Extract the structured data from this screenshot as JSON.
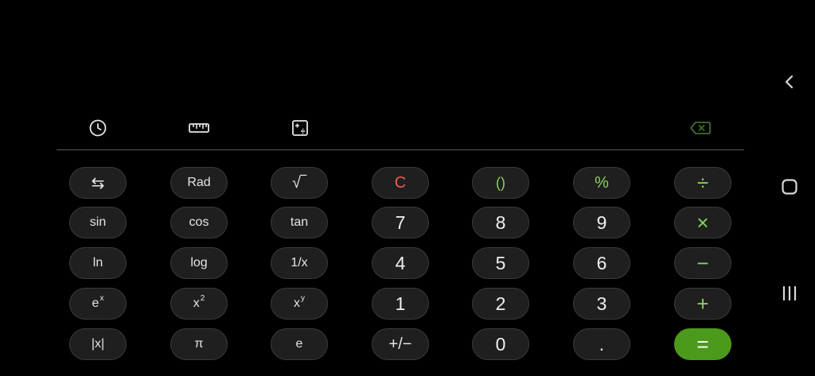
{
  "display": {
    "expression": "",
    "result": ""
  },
  "toolbar": {
    "history_icon": "clock-icon",
    "converter_icon": "ruler-icon",
    "calc_mode_icon": "calculator-icon",
    "backspace_icon": "backspace-icon"
  },
  "colors": {
    "background": "#000000",
    "key_bg": "#1f1f1f",
    "accent_green": "#8ad25c",
    "equals_bg": "#4c9a1c",
    "clear_red": "#f05a50",
    "divider": "#5a5a5a"
  },
  "keys": {
    "swap": "⇆",
    "rad": "Rad",
    "sqrt": "√‾",
    "clear": "C",
    "parens": "()",
    "percent": "%",
    "divide": "÷",
    "sin": "sin",
    "cos": "cos",
    "tan": "tan",
    "seven": "7",
    "eight": "8",
    "nine": "9",
    "multiply": "×",
    "ln": "ln",
    "log": "log",
    "reciprocal": "1/x",
    "four": "4",
    "five": "5",
    "six": "6",
    "minus": "−",
    "exp_base": "e",
    "exp_power": "x",
    "square_base": "x",
    "square_power": "2",
    "power_base": "x",
    "power_power": "y",
    "one": "1",
    "two": "2",
    "three": "3",
    "plus": "+",
    "abs": "|x|",
    "pi": "π",
    "e": "e",
    "negate": "+/−",
    "zero": "0",
    "decimal": ".",
    "equals": "="
  },
  "navbar": {
    "back_icon": "chevron-left-icon",
    "home_icon": "home-icon",
    "recents_icon": "recents-icon"
  }
}
